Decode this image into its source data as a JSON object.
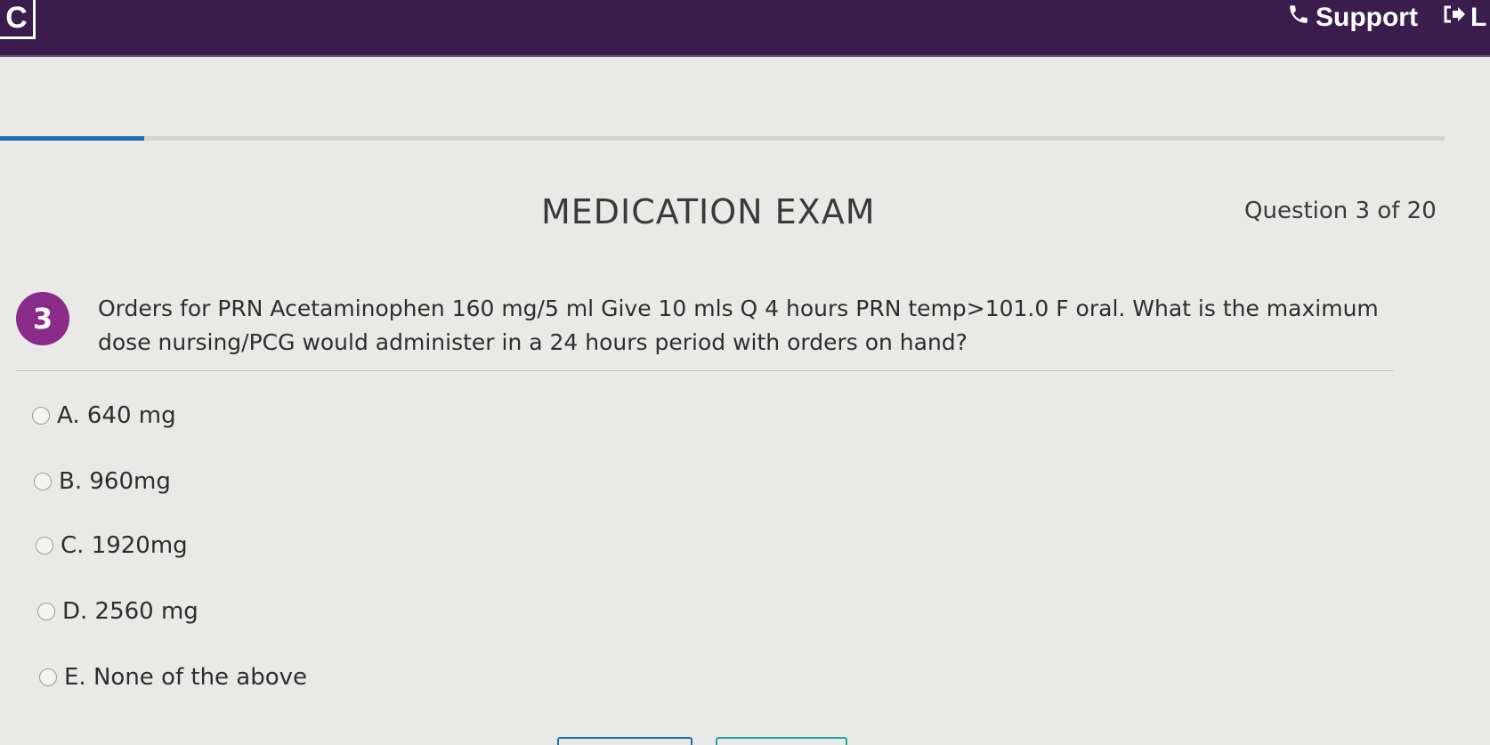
{
  "topbar": {
    "logo_letter": "C",
    "support_label": "Support",
    "logout_label": "L"
  },
  "progress": {
    "current": 3,
    "total": 20
  },
  "exam": {
    "title": "MEDICATION EXAM",
    "question_count": "Question 3 of 20"
  },
  "question": {
    "number": "3",
    "text": "Orders for PRN Acetaminophen 160 mg/5 ml Give 10 mls Q 4  hours PRN temp>101.0 F oral. What is the maximum dose nursing/PCG would administer in a 24 hours period with orders on hand?"
  },
  "options": [
    {
      "label": "A. 640 mg"
    },
    {
      "label": "B. 960mg"
    },
    {
      "label": "C. 1920mg"
    },
    {
      "label": "D. 2560 mg"
    },
    {
      "label": "E. None of the above"
    }
  ],
  "colors": {
    "topbar": "#3a1d4c",
    "accent": "#8a2b8a",
    "progress": "#1e6fb5",
    "button_left": "#1e6fb5",
    "button_right": "#2aa6a6"
  },
  "icons": {
    "support": "phone-icon",
    "logout": "sign-out-icon"
  }
}
